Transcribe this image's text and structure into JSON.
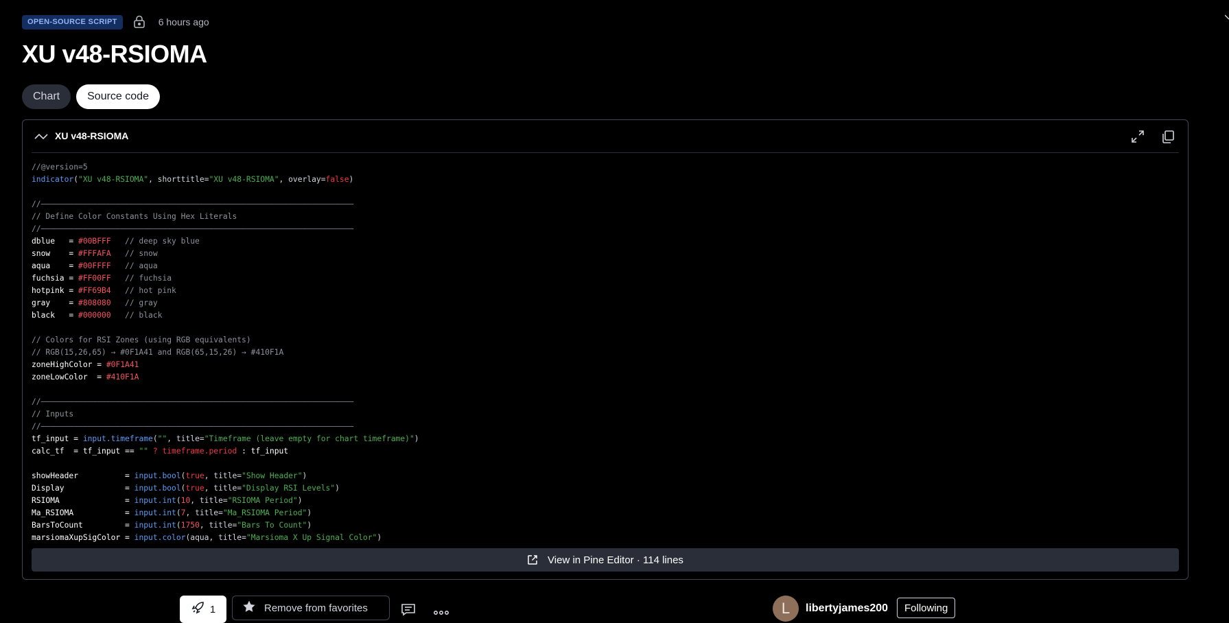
{
  "header": {
    "badge": "OPEN-SOURCE SCRIPT",
    "time_ago": "6 hours ago",
    "title": "XU v48-RSIOMA"
  },
  "tabs": [
    {
      "label": "Chart",
      "active": false
    },
    {
      "label": "Source code",
      "active": true
    }
  ],
  "code_panel": {
    "title": "XU v48-RSIOMA",
    "view_editor_label": "View in Pine Editor · 114 lines"
  },
  "bottom": {
    "boost_count": "1",
    "favorite_label": "Remove from favorites",
    "avatar_letter": "L",
    "author": "libertyjames200",
    "follow_label": "Following"
  },
  "icons": {
    "lock": "lock-icon",
    "wave": "wave-icon",
    "expand": "expand-icon",
    "copy": "copy-icon",
    "external": "external-link-icon",
    "rocket": "rocket-icon",
    "star": "star-icon",
    "comment": "comment-icon",
    "more": "more-icon"
  },
  "colors": {
    "badge_bg": "#142e61",
    "badge_text": "#91b4f5",
    "string": "#4caf50",
    "function": "#5b9cf6",
    "number": "#f7525f",
    "comment": "#8e9199"
  },
  "code_lines": [
    [
      {
        "t": "//@version=5",
        "c": "com"
      }
    ],
    [
      {
        "t": "indicator",
        "c": "fn"
      },
      {
        "t": "("
      },
      {
        "t": "\"XU v48-RSIOMA\"",
        "c": "str"
      },
      {
        "t": ", shorttitle="
      },
      {
        "t": "\"XU v48-RSIOMA\"",
        "c": "str"
      },
      {
        "t": ", overlay="
      },
      {
        "t": "false",
        "c": "kw"
      },
      {
        "t": ")"
      }
    ],
    [],
    [
      {
        "t": "//———————————————————————————————————————————————————————————————————",
        "c": "com"
      }
    ],
    [
      {
        "t": "// Define Color Constants Using Hex Literals",
        "c": "com"
      }
    ],
    [
      {
        "t": "//———————————————————————————————————————————————————————————————————",
        "c": "com"
      }
    ],
    [
      {
        "t": "dblue   = ",
        "c": "var"
      },
      {
        "t": "#00BFFF",
        "c": "num"
      },
      {
        "t": "   // deep sky blue",
        "c": "com"
      }
    ],
    [
      {
        "t": "snow    = ",
        "c": "var"
      },
      {
        "t": "#FFFAFA",
        "c": "num"
      },
      {
        "t": "   // snow",
        "c": "com"
      }
    ],
    [
      {
        "t": "aqua    = ",
        "c": "var"
      },
      {
        "t": "#00FFFF",
        "c": "num"
      },
      {
        "t": "   // aqua",
        "c": "com"
      }
    ],
    [
      {
        "t": "fuchsia = ",
        "c": "var"
      },
      {
        "t": "#FF00FF",
        "c": "num"
      },
      {
        "t": "   // fuchsia",
        "c": "com"
      }
    ],
    [
      {
        "t": "hotpink = ",
        "c": "var"
      },
      {
        "t": "#FF69B4",
        "c": "num"
      },
      {
        "t": "   // hot pink",
        "c": "com"
      }
    ],
    [
      {
        "t": "gray    = ",
        "c": "var"
      },
      {
        "t": "#808080",
        "c": "num"
      },
      {
        "t": "   // gray",
        "c": "com"
      }
    ],
    [
      {
        "t": "black   = ",
        "c": "var"
      },
      {
        "t": "#000000",
        "c": "num"
      },
      {
        "t": "   // black",
        "c": "com"
      }
    ],
    [],
    [
      {
        "t": "// Colors for RSI Zones (using RGB equivalents)",
        "c": "com"
      }
    ],
    [
      {
        "t": "// RGB(15,26,65) → #0F1A41 and RGB(65,15,26) → #410F1A",
        "c": "com"
      }
    ],
    [
      {
        "t": "zoneHighColor = ",
        "c": "var"
      },
      {
        "t": "#0F1A41",
        "c": "num"
      }
    ],
    [
      {
        "t": "zoneLowColor  = ",
        "c": "var"
      },
      {
        "t": "#410F1A",
        "c": "num"
      }
    ],
    [],
    [
      {
        "t": "//———————————————————————————————————————————————————————————————————",
        "c": "com"
      }
    ],
    [
      {
        "t": "// Inputs",
        "c": "com"
      }
    ],
    [
      {
        "t": "//———————————————————————————————————————————————————————————————————",
        "c": "com"
      }
    ],
    [
      {
        "t": "tf_input = ",
        "c": "var"
      },
      {
        "t": "input.timeframe",
        "c": "fn"
      },
      {
        "t": "("
      },
      {
        "t": "\"\"",
        "c": "str"
      },
      {
        "t": ", title="
      },
      {
        "t": "\"Timeframe (leave empty for chart timeframe)\"",
        "c": "str"
      },
      {
        "t": ")"
      }
    ],
    [
      {
        "t": "calc_tf  = tf_input == ",
        "c": "var"
      },
      {
        "t": "\"\"",
        "c": "str"
      },
      {
        "t": " ? ",
        "c": "kw"
      },
      {
        "t": "timeframe.period",
        "c": "kw"
      },
      {
        "t": " : tf_input",
        "c": "var"
      }
    ],
    [],
    [
      {
        "t": "showHeader          = ",
        "c": "var"
      },
      {
        "t": "input.bool",
        "c": "fn"
      },
      {
        "t": "("
      },
      {
        "t": "true",
        "c": "kw"
      },
      {
        "t": ", title="
      },
      {
        "t": "\"Show Header\"",
        "c": "str"
      },
      {
        "t": ")"
      }
    ],
    [
      {
        "t": "Display             = ",
        "c": "var"
      },
      {
        "t": "input.bool",
        "c": "fn"
      },
      {
        "t": "("
      },
      {
        "t": "true",
        "c": "kw"
      },
      {
        "t": ", title="
      },
      {
        "t": "\"Display RSI Levels\"",
        "c": "str"
      },
      {
        "t": ")"
      }
    ],
    [
      {
        "t": "RSIOMA              = ",
        "c": "var"
      },
      {
        "t": "input.int",
        "c": "fn"
      },
      {
        "t": "("
      },
      {
        "t": "10",
        "c": "num"
      },
      {
        "t": ", title="
      },
      {
        "t": "\"RSIOMA Period\"",
        "c": "str"
      },
      {
        "t": ")"
      }
    ],
    [
      {
        "t": "Ma_RSIOMA           = ",
        "c": "var"
      },
      {
        "t": "input.int",
        "c": "fn"
      },
      {
        "t": "("
      },
      {
        "t": "7",
        "c": "num"
      },
      {
        "t": ", title="
      },
      {
        "t": "\"Ma_RSIOMA Period\"",
        "c": "str"
      },
      {
        "t": ")"
      }
    ],
    [
      {
        "t": "BarsToCount         = ",
        "c": "var"
      },
      {
        "t": "input.int",
        "c": "fn"
      },
      {
        "t": "("
      },
      {
        "t": "1750",
        "c": "num"
      },
      {
        "t": ", title="
      },
      {
        "t": "\"Bars To Count\"",
        "c": "str"
      },
      {
        "t": ")"
      }
    ],
    [
      {
        "t": "marsiomaXupSigColor = ",
        "c": "var"
      },
      {
        "t": "input.color",
        "c": "fn"
      },
      {
        "t": "(aqua, title="
      },
      {
        "t": "\"Marsioma X Up Signal Color\"",
        "c": "str"
      },
      {
        "t": ")"
      }
    ]
  ]
}
